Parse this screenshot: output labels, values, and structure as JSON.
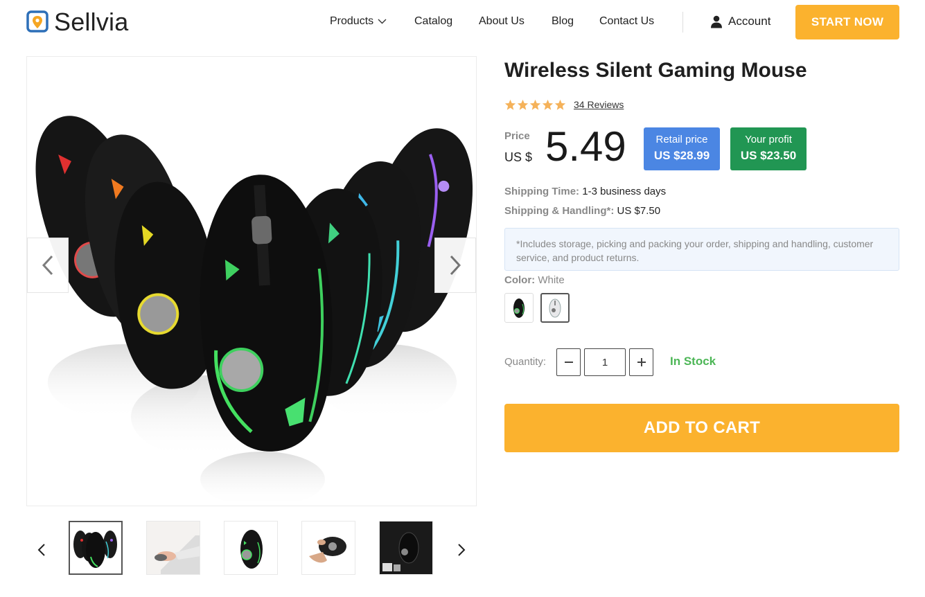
{
  "brand": {
    "name": "Sellvia",
    "logo_icon": "location-pin-logo-icon",
    "color": "#2d6fb8"
  },
  "nav": {
    "items": [
      {
        "label": "Products",
        "has_dropdown": true
      },
      {
        "label": "Catalog"
      },
      {
        "label": "About Us"
      },
      {
        "label": "Blog"
      },
      {
        "label": "Contact Us"
      }
    ],
    "account_label": "Account",
    "account_icon": "user-icon",
    "cta_label": "START NOW"
  },
  "gallery": {
    "main_image": "gaming-mice-group-image",
    "prev_icon": "chevron-left-icon",
    "next_icon": "chevron-right-icon",
    "thumbnails": [
      {
        "name": "mice-group-thumb",
        "active": true
      },
      {
        "name": "hand-on-laptop-thumb",
        "active": false
      },
      {
        "name": "black-mouse-thumb",
        "active": false
      },
      {
        "name": "hand-holding-mouse-thumb",
        "active": false
      },
      {
        "name": "mouse-box-thumb",
        "active": false
      }
    ]
  },
  "product": {
    "title": "Wireless Silent Gaming Mouse",
    "rating": 5,
    "reviews_label": "34 Reviews",
    "price_label": "Price",
    "price_currency": "US $",
    "price_value": "5.49",
    "retail": {
      "label": "Retail price",
      "value": "US $28.99",
      "color": "#4b86e3"
    },
    "profit": {
      "label": "Your profit",
      "value": "US $23.50",
      "color": "#219653"
    },
    "shipping_time": {
      "label": "Shipping Time:",
      "value": "1-3 business days"
    },
    "shipping_handling": {
      "label": "Shipping & Handling*:",
      "value": "US $7.50"
    },
    "note": "*Includes storage, picking and packing your order, shipping and handling, customer service, and product returns.",
    "color_label": "Color:",
    "color_value": "White",
    "swatches": [
      {
        "name": "black",
        "selected": false
      },
      {
        "name": "white",
        "selected": true
      }
    ],
    "quantity_label": "Quantity:",
    "quantity": "1",
    "stock_status": "In Stock",
    "stock_color": "#4cb656",
    "add_to_cart_label": "ADD TO CART",
    "accent_color": "#fbb22e"
  }
}
